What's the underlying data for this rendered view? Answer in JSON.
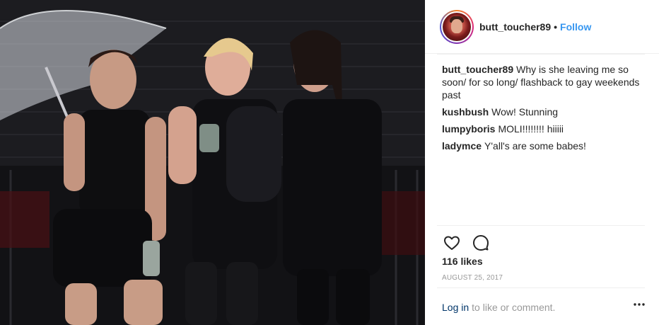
{
  "post": {
    "photo_alt": "",
    "header": {
      "username": "butt_toucher89",
      "separator": "•",
      "follow_label": "Follow"
    },
    "comments": [
      {
        "author": "butt_toucher89",
        "text": "Why is she leaving me so soon/ for so long/ flashback to gay weekends past"
      },
      {
        "author": "kushbush",
        "text": "Wow! Stunning"
      },
      {
        "author": "lumpyboris",
        "text": "MOLI!!!!!!!! hiiiii"
      },
      {
        "author": "ladymce",
        "text": "Y'all's are some babes!"
      }
    ],
    "actions": {
      "like_icon": "heart-icon",
      "comment_icon": "comment-icon"
    },
    "likes": "116 likes",
    "date": "AUGUST 25, 2017",
    "login": {
      "link_label": "Log in",
      "suffix": "to like or comment.",
      "more_icon": "more-options-icon"
    },
    "colors": {
      "link_blue": "#3897f0",
      "login_link": "#003569",
      "muted_text": "#999999",
      "text": "#262626"
    }
  }
}
